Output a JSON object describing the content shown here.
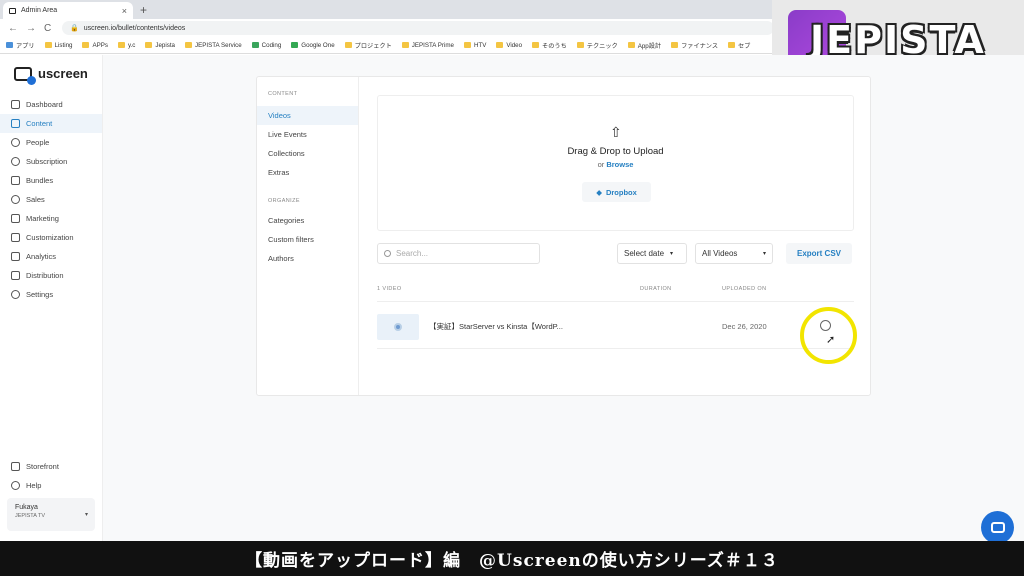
{
  "browser": {
    "tab_title": "Admin Area",
    "new_tab": "+",
    "url": "uscreen.io/bullet/contents/videos",
    "nav_back": "←",
    "nav_forward": "→",
    "reload": "C",
    "bookmarks": [
      "アプリ",
      "Listing",
      "APPs",
      "y.c",
      "Jepista",
      "JEPISTA Service",
      "Coding",
      "Google One",
      "プロジェクト",
      "JEPISTA Prime",
      "HTV",
      "Video",
      "そのうち",
      "テクニック",
      "App設計",
      "ファイナンス",
      "セブ"
    ]
  },
  "overlay_logo": "JEPISTA",
  "app": {
    "brand": "uscreen",
    "nav": [
      {
        "label": "Dashboard",
        "icon": "dashboard-icon"
      },
      {
        "label": "Content",
        "icon": "folder-icon",
        "active": true
      },
      {
        "label": "People",
        "icon": "people-icon"
      },
      {
        "label": "Subscription",
        "icon": "subscription-icon"
      },
      {
        "label": "Bundles",
        "icon": "bundle-icon"
      },
      {
        "label": "Sales",
        "icon": "dollar-icon"
      },
      {
        "label": "Marketing",
        "icon": "megaphone-icon"
      },
      {
        "label": "Customization",
        "icon": "edit-icon"
      },
      {
        "label": "Analytics",
        "icon": "chart-icon"
      },
      {
        "label": "Distribution",
        "icon": "distribution-icon"
      },
      {
        "label": "Settings",
        "icon": "gear-icon"
      }
    ],
    "bottom_nav": [
      {
        "label": "Storefront",
        "icon": "storefront-icon"
      },
      {
        "label": "Help",
        "icon": "help-icon"
      }
    ],
    "account": {
      "name": "Fukaya",
      "org": "JEPISTA TV"
    }
  },
  "content": {
    "section_content": "CONTENT",
    "items": [
      "Videos",
      "Live Events",
      "Collections",
      "Extras"
    ],
    "section_organize": "ORGANIZE",
    "organize_items": [
      "Categories",
      "Custom filters",
      "Authors"
    ],
    "upload": {
      "title": "Drag & Drop to Upload",
      "or": "or",
      "browse": "Browse",
      "dropbox": "Dropbox"
    },
    "search_placeholder": "Search...",
    "date_filter": "Select date",
    "video_filter": "All Videos",
    "export": "Export CSV",
    "columns": {
      "count": "1 VIDEO",
      "duration": "DURATION",
      "uploaded": "UPLOADED ON"
    },
    "rows": [
      {
        "title": "【実証】StarServer vs Kinsta【WordP...",
        "duration": "",
        "uploaded": "Dec 26, 2020"
      }
    ]
  },
  "caption": "【動画をアップロード】編　@Uscreenの使い方シリーズ＃１３"
}
